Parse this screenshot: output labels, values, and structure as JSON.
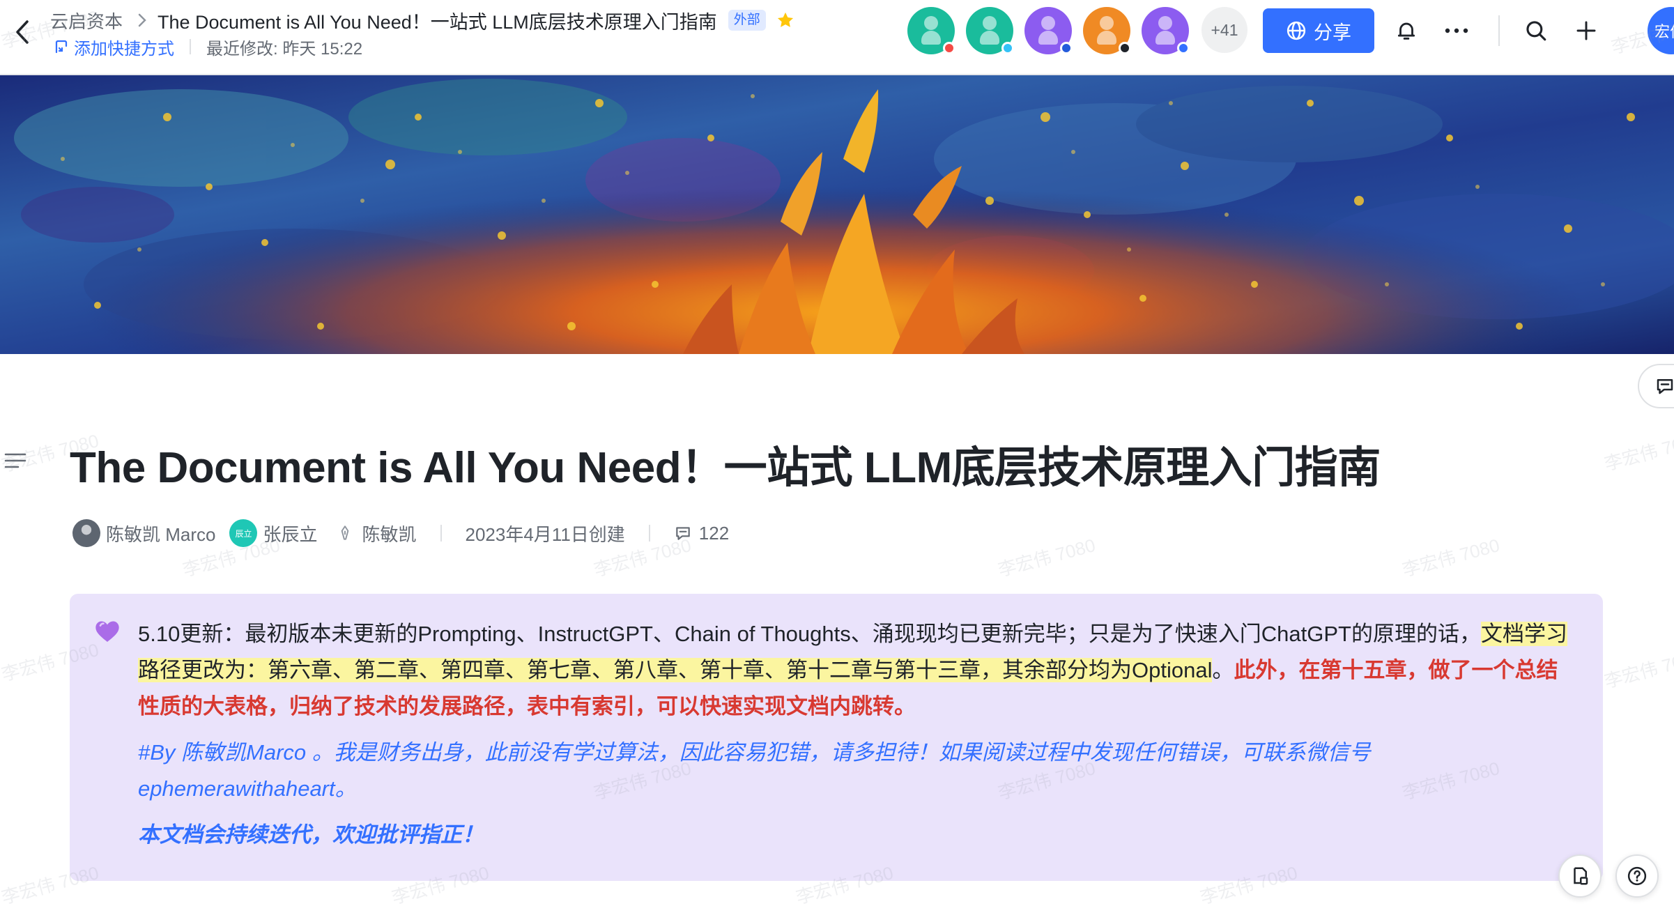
{
  "header": {
    "breadcrumb_root": "云启资本",
    "doc_title": "The Document is All You Need！一站式 LLM底层技术原理入门指南",
    "external_badge": "外部",
    "add_shortcut": "添加快捷方式",
    "last_modified": "最近修改: 昨天 15:22",
    "more_collaborators": "+41",
    "share_label": "分享",
    "me_avatar_text": "宏伟"
  },
  "collaborators": [
    {
      "color": "#1abc9c",
      "dot": "#f54a45"
    },
    {
      "color": "#1abc9c",
      "dot": "#34c2f7"
    },
    {
      "color": "#8c5cf0",
      "dot": "#245bdb"
    },
    {
      "color": "#f08a24",
      "dot": "#1f2329"
    },
    {
      "color": "#8c5cf0",
      "dot": "#3370ff"
    }
  ],
  "document": {
    "title": "The Document is All You Need！一站式 LLM底层技术原理入门指南",
    "authors": [
      {
        "name": "陈敏凯 Marco"
      },
      {
        "name": "张辰立",
        "avatar_text": "辰立"
      },
      {
        "name": "陈敏凯"
      }
    ],
    "created": "2023年4月11日创建",
    "comment_count": "122"
  },
  "callout": {
    "emoji": "purple-heart",
    "text_plain": "5.10更新：最初版本未更新的Prompting、InstructGPT、Chain of Thoughts、涌现现均已更新完毕；只是为了快速入门ChatGPT的原理的话，",
    "text_highlight": "文档学习路径更改为：第六章、第二章、第四章、第七章、第八章、第十章、第十二章与第十三章，其余部分均为Optional",
    "text_after": "。",
    "text_red": "此外，在第十五章，做了一个总结性质的大表格，归纳了技术的发展路径，表中有索引，可以快速实现文档内跳转。",
    "by_line": "#By 陈敏凯Marco 。我是财务出身，此前没有学过算法，因此容易犯错，请多担待！如果阅读过程中发现任何错误，可联系微信号ephemerawithaheart。",
    "closing": "本文档会持续迭代，欢迎批评指正！"
  },
  "watermark": "李宏伟 7080",
  "colors": {
    "accent": "#3370ff",
    "callout_bg": "#eae3fb",
    "highlight": "#fbf5a0",
    "red_text": "#d83931"
  }
}
